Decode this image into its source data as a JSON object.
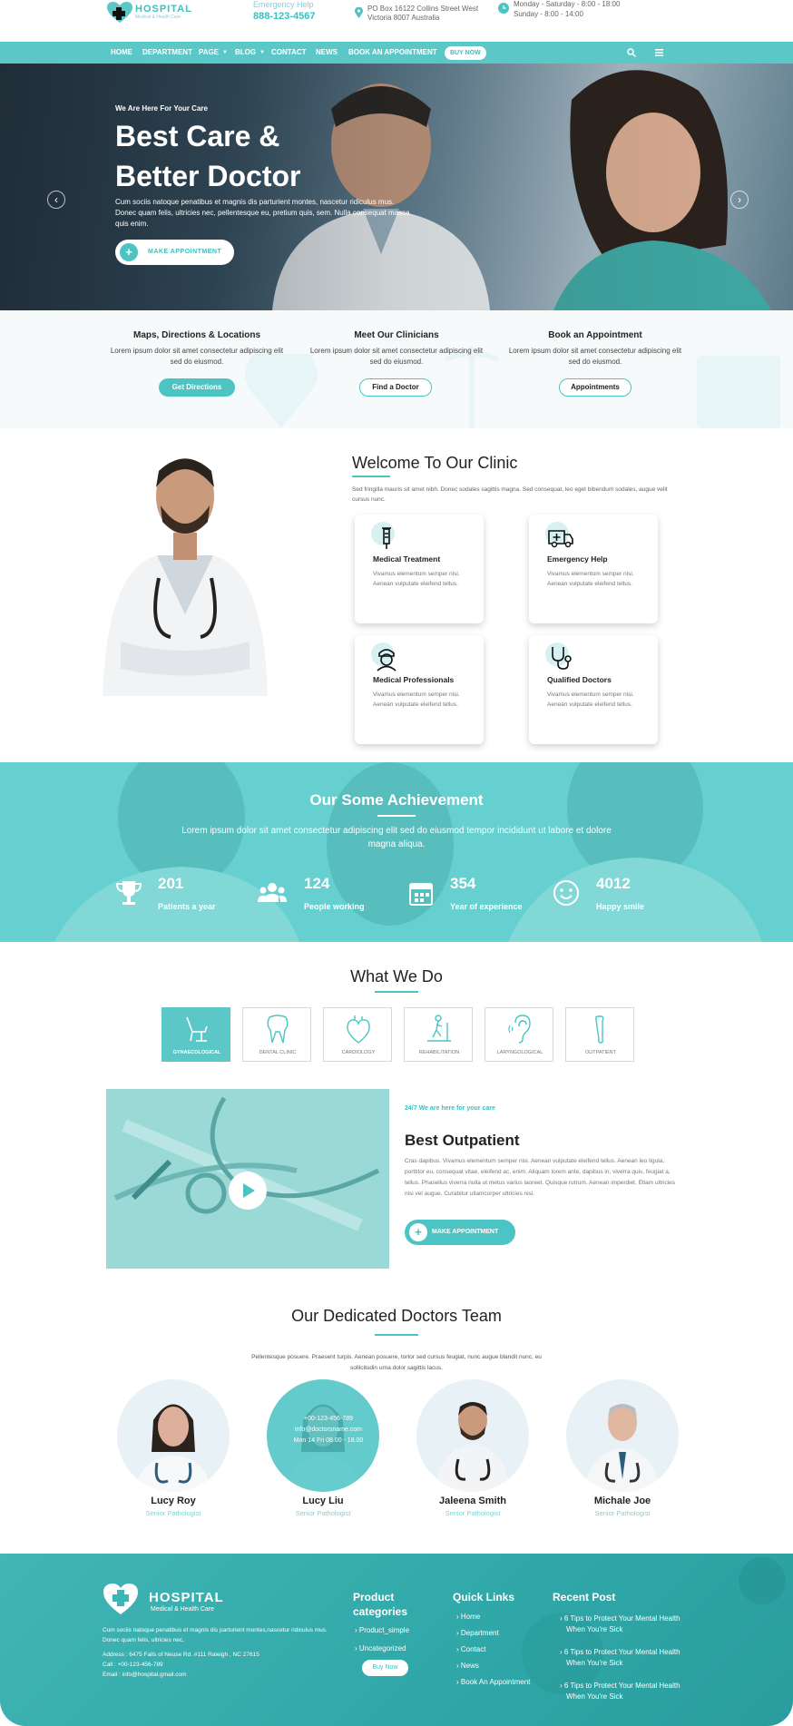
{
  "brand": {
    "name": "HOSPITAL",
    "tagline": "Medical & Health Care"
  },
  "topbar": {
    "emergency_label": "Emergency Help",
    "phone": "888-123-4567",
    "address_line1": "PO Box 16122 Collins Street West",
    "address_line2": "Victoria 8007 Australia",
    "hours_line1": "Monday - Saturday - 8:00 - 18:00",
    "hours_line2": "Sunday - 8:00 - 14:00"
  },
  "nav": {
    "items": [
      "HOME",
      "DEPARTMENT",
      "PAGE",
      "BLOG",
      "CONTACT",
      "NEWS",
      "BOOK AN APPOINTMENT"
    ],
    "buy_label": "BUY NOW"
  },
  "hero": {
    "kicker": "We Are Here For Your Care",
    "title_line1": "Best Care &",
    "title_line2": "Better Doctor",
    "text": "Cum sociis natoque penatibus et magnis dis parturient montes, nascetur ridiculus mus. Donec quam felis, ultricies nec, pellentesque eu, pretium quis, sem. Nulla consequat massa quis enim.",
    "button": "MAKE APPOINTMENT"
  },
  "info": [
    {
      "title": "Maps, Directions & Locations",
      "text": "Lorem ipsum dolor sit amet consectetur adipiscing elit sed do eiusmod.",
      "button": "Get Directions"
    },
    {
      "title": "Meet Our Clinicians",
      "text": "Lorem ipsum dolor sit amet consectetur adipiscing elit sed do eiusmod.",
      "button": "Find a Doctor"
    },
    {
      "title": "Book an Appointment",
      "text": "Lorem ipsum dolor sit amet consectetur adipiscing elit sed do eiusmod.",
      "button": "Appointments"
    }
  ],
  "welcome": {
    "title": "Welcome To Our Clinic",
    "text": "Sed fringilla mauris sit amet nibh. Donec sodales sagittis magna. Sed consequat, leo eget bibendum sodales, augue velit cursus nunc.",
    "features": [
      {
        "title": "Medical Treatment",
        "text": "Vivamus elementum semper nisi. Aenean vulputate eleifend tellus."
      },
      {
        "title": "Emergency Help",
        "text": "Vivamus elementum semper nisi. Aenean vulputate eleifend tellus."
      },
      {
        "title": "Medical Professionals",
        "text": "Vivamus elementum semper nisi. Aenean vulputate eleifend tellus."
      },
      {
        "title": "Qualified Doctors",
        "text": "Vivamus elementum semper nisi. Aenean vulputate eleifend tellus."
      }
    ]
  },
  "achievement": {
    "title": "Our Some Achievement",
    "text": "Lorem ipsum dolor sit amet consectetur adipiscing elit sed do eiusmod tempor incididunt ut labore et dolore magna aliqua.",
    "stats": [
      {
        "value": "201",
        "label": "Patients a year",
        "icon": "trophy-icon"
      },
      {
        "value": "124",
        "label": "People working",
        "icon": "people-icon"
      },
      {
        "value": "354",
        "label": "Year of experience",
        "icon": "calendar-icon"
      },
      {
        "value": "4012",
        "label": "Happy smile",
        "icon": "smile-icon"
      }
    ]
  },
  "whatwedo": {
    "title": "What We Do",
    "tabs": [
      "GYNAECOLOGICAL",
      "DENTAL CLINIC",
      "CARDIOLOGY",
      "REHABILITATION",
      "LARYNGOLOGICAL",
      "OUTPATIENT"
    ],
    "kicker": "24/7 We are here for your care",
    "heading": "Best Outpatient",
    "text": "Cras dapibus. Vivamus elementum semper nisi. Aenean vulputate eleifend tellus. Aenean leo ligula, porttitor eu, consequat vitae, eleifend ac, enim. Aliquam lorem ante, dapibus in, viverra quis, feugiat a, tellus. Phasellus viverra nulla ut metus varius laoreet. Quisque rutrum. Aenean imperdiet. Etiam ultricies nisi vel augue. Curabitur ullamcorper ultricies nisi.",
    "button": "MAKE APPOINTMENT"
  },
  "doctors": {
    "title": "Our Dedicated Doctors Team",
    "intro": "Pellentesque posuere. Praesent turpis. Aenean posuere, tortor sed cursus feugiat, nunc augue blandit nunc, eu sollicitudin urna dolor sagittis lacus.",
    "overlay": {
      "phone": "+00-123-456-789",
      "email": "info@doctorsname.com",
      "hours": "Mon 14 Fri 08.00 - 18.00"
    },
    "items": [
      {
        "name": "Lucy Roy",
        "role": "Senior Pathologist"
      },
      {
        "name": "Lucy Liu",
        "role": "Senior Pathologist"
      },
      {
        "name": "Jaleena Smith",
        "role": "Senior Pathologist"
      },
      {
        "name": "Michale Joe",
        "role": "Senior Pathologist"
      }
    ]
  },
  "footer": {
    "text": "Cum sociis natoque penatibus et magnis dis parturient montes,nascetur ridiculus mus. Donec quam felis, ultricies nec,",
    "address": "Address : 6475 Falls of Neuse Rd. #111 Raleigh , NC 27615",
    "call": "Call : +00-123-456-789",
    "email": "Email : info@hospital.gmail.com",
    "product_head_1": "Product",
    "product_head_2": "categories",
    "products": [
      "Product_simple",
      "Uncategorized"
    ],
    "buy": "Buy Now",
    "quick_head": "Quick Links",
    "quick": [
      "Home",
      "Department",
      "Contact",
      "News",
      "Book An Appointment"
    ],
    "recent_head": "Recent Post",
    "posts": [
      {
        "l1": "6 Tips to Protect Your Mental Health",
        "l2": "When You're Sick"
      },
      {
        "l1": "6 Tips to Protect Your Mental Health",
        "l2": "When You're Sick"
      },
      {
        "l1": "6 Tips to Protect Your Mental Health",
        "l2": "When You're Sick"
      }
    ]
  },
  "colors": {
    "accent": "#4cc4c4",
    "nav": "#5cc7c7",
    "footer": "#2fa7a8"
  }
}
